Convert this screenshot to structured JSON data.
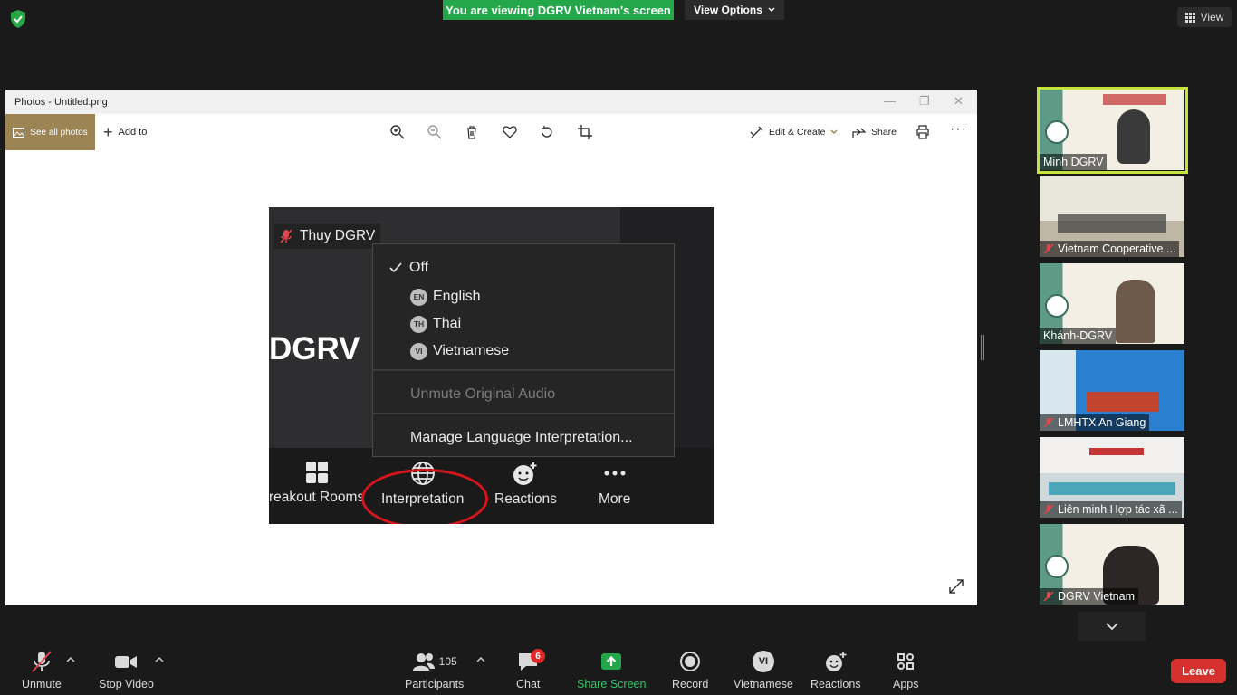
{
  "top_bar": {
    "banner_text": "You are viewing DGRV Vietnam's screen",
    "view_options_label": "View Options",
    "view_label": "View"
  },
  "photos_app": {
    "title": "Photos - Untitled.png",
    "see_all_photos": "See all photos",
    "add_to": "Add to",
    "edit_create": "Edit & Create",
    "share": "Share"
  },
  "shared_image": {
    "participant_name": "Thuy DGRV",
    "logo_text": "DGRV",
    "menu": {
      "off_label": "Off",
      "languages": [
        {
          "code": "EN",
          "name": "English"
        },
        {
          "code": "TH",
          "name": "Thai"
        },
        {
          "code": "VI",
          "name": "Vietnamese"
        }
      ],
      "unmute_original_audio": "Unmute Original Audio",
      "manage_interpretation": "Manage Language Interpretation..."
    },
    "toolbar": {
      "breakout_rooms": "reakout Rooms",
      "interpretation": "Interpretation",
      "reactions": "Reactions",
      "more": "More"
    }
  },
  "gallery": {
    "tiles": [
      {
        "name": "Minh DGRV",
        "muted": false,
        "active": true
      },
      {
        "name": "Vietnam Cooperative ...",
        "muted": true,
        "active": false
      },
      {
        "name": "Khánh-DGRV",
        "muted": false,
        "active": false
      },
      {
        "name": "LMHTX An Giang",
        "muted": true,
        "active": false
      },
      {
        "name": "Liên minh Hợp tác xã ...",
        "muted": true,
        "active": false
      },
      {
        "name": "DGRV Vietnam",
        "muted": true,
        "active": false
      }
    ]
  },
  "bottom_bar": {
    "unmute": "Unmute",
    "stop_video": "Stop Video",
    "participants": "Participants",
    "participants_count": "105",
    "chat": "Chat",
    "chat_badge": "6",
    "share_screen": "Share Screen",
    "record": "Record",
    "language": "Vietnamese",
    "language_code": "VI",
    "reactions": "Reactions",
    "apps": "Apps",
    "leave": "Leave"
  },
  "colors": {
    "banner_green": "#23a74a",
    "share_green": "#34c76a",
    "leave_red": "#d6312c",
    "active_speaker": "#c6e33b",
    "annotation_red": "#d4151c",
    "photos_accent": "#9c8455"
  }
}
